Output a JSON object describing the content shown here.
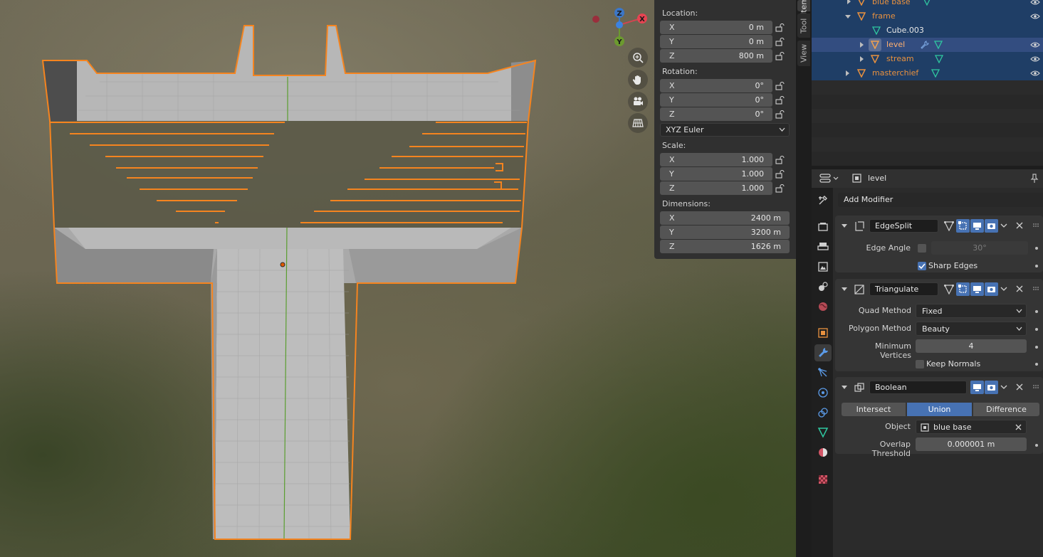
{
  "viewport": {
    "gizmo": {
      "x": "X",
      "y": "Y",
      "z": "Z"
    }
  },
  "npanel": {
    "location_label": "Location:",
    "location": [
      {
        "axis": "X",
        "value": "0 m"
      },
      {
        "axis": "Y",
        "value": "0 m"
      },
      {
        "axis": "Z",
        "value": "800 m"
      }
    ],
    "rotation_label": "Rotation:",
    "rotation": [
      {
        "axis": "X",
        "value": "0°"
      },
      {
        "axis": "Y",
        "value": "0°"
      },
      {
        "axis": "Z",
        "value": "0°"
      }
    ],
    "rotation_mode": "XYZ Euler",
    "scale_label": "Scale:",
    "scale": [
      {
        "axis": "X",
        "value": "1.000"
      },
      {
        "axis": "Y",
        "value": "1.000"
      },
      {
        "axis": "Z",
        "value": "1.000"
      }
    ],
    "dimensions_label": "Dimensions:",
    "dimensions": [
      {
        "axis": "X",
        "value": "2400 m"
      },
      {
        "axis": "Y",
        "value": "3200 m"
      },
      {
        "axis": "Z",
        "value": "1626 m"
      }
    ]
  },
  "sidebar_tabs": [
    "Item",
    "Tool",
    "View"
  ],
  "outliner": {
    "rows": [
      {
        "name": "blue base"
      },
      {
        "name": "frame"
      },
      {
        "name": "Cube.003"
      },
      {
        "name": "level"
      },
      {
        "name": "stream"
      },
      {
        "name": "masterchief"
      }
    ]
  },
  "properties": {
    "object_name": "level",
    "add_modifier": "Add Modifier",
    "edgesplit": {
      "name": "EdgeSplit",
      "edge_angle_label": "Edge Angle",
      "edge_angle_value": "30°",
      "sharp_edges_label": "Sharp Edges"
    },
    "triangulate": {
      "name": "Triangulate",
      "quad_method_label": "Quad Method",
      "quad_method_value": "Fixed",
      "polygon_method_label": "Polygon Method",
      "polygon_method_value": "Beauty",
      "min_vertices_label": "Minimum Vertices",
      "min_vertices_value": "4",
      "keep_normals_label": "Keep Normals"
    },
    "boolean": {
      "name": "Boolean",
      "ops": [
        "Intersect",
        "Union",
        "Difference"
      ],
      "object_label": "Object",
      "object_value": "blue base",
      "overlap_label": "Overlap Threshold",
      "overlap_value": "0.000001 m"
    }
  },
  "colors": {
    "selection_orange": "#f5841f",
    "active_blue": "#4772b3",
    "mesh_green": "#2fc7a0",
    "panel_bg": "#303030"
  }
}
